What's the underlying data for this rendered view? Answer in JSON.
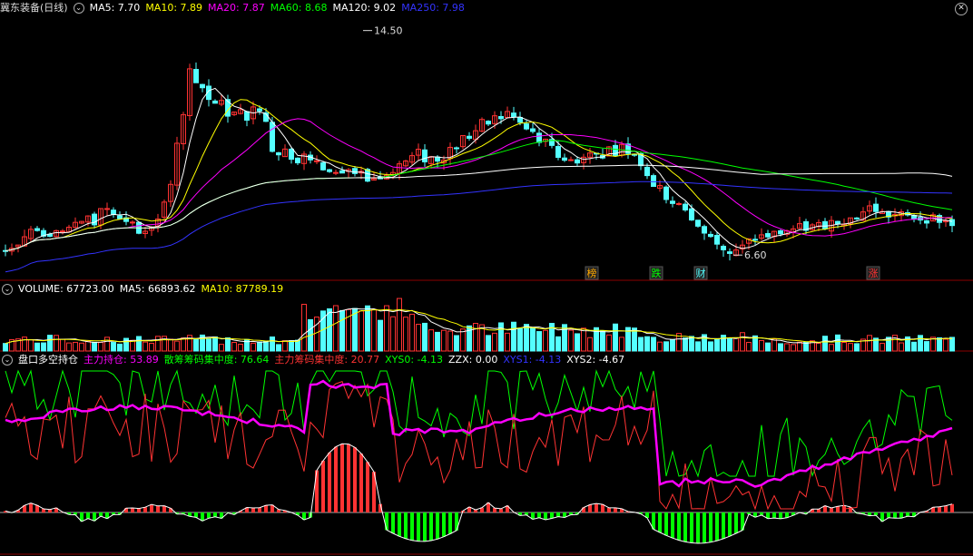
{
  "header": {
    "stock_name": "冀东装备(日线)",
    "ma_labels": [
      {
        "text": "MA5: 7.70",
        "color": "#ffffff"
      },
      {
        "text": "MA10: 7.89",
        "color": "#ffff00"
      },
      {
        "text": "MA20: 7.87",
        "color": "#ff00ff"
      },
      {
        "text": "MA60: 8.68",
        "color": "#00ff00"
      },
      {
        "text": "MA120: 9.02",
        "color": "#ffffff"
      },
      {
        "text": "MA250: 7.98",
        "color": "#3333ff"
      }
    ]
  },
  "volume_header": {
    "labels": [
      {
        "text": "VOLUME: 67723.00",
        "color": "#ffffff"
      },
      {
        "text": "MA5: 66893.62",
        "color": "#ffffff"
      },
      {
        "text": "MA10: 87789.19",
        "color": "#ffff00"
      }
    ]
  },
  "indicator_header": {
    "labels": [
      {
        "text": "盘口多空持仓",
        "color": "#ffffff"
      },
      {
        "text": "主力持仓: 53.89",
        "color": "#ff00ff"
      },
      {
        "text": "散筹筹码集中度: 76.64",
        "color": "#00ff00"
      },
      {
        "text": "主力筹码集中度: 20.77",
        "color": "#ff3333"
      },
      {
        "text": "XYS0: -4.13",
        "color": "#00ff00"
      },
      {
        "text": "ZZX: 0.00",
        "color": "#ffffff"
      },
      {
        "text": "XYS1: -4.13",
        "color": "#3333ff"
      },
      {
        "text": "XYS2: -4.67",
        "color": "#ffffff"
      }
    ]
  },
  "colors": {
    "up": "#ff3333",
    "down": "#54ffff",
    "ma5": "#ffffff",
    "ma10": "#ffff00",
    "ma20": "#ff00ff",
    "ma60": "#00ff00",
    "ma120": "#ffffff",
    "ma250": "#3333ff",
    "grid": "#8b0000"
  },
  "chart_data": [
    {
      "type": "candlestick",
      "title": "冀东装备(日线)",
      "ylim": [
        6.0,
        15.0
      ],
      "annotations": [
        {
          "text": "14.50",
          "value": 14.5
        },
        {
          "text": "6.60",
          "value": 6.6
        }
      ],
      "markers": [
        {
          "text": "榜",
          "color": "#ffaa00"
        },
        {
          "text": "跌",
          "color": "#00ff00"
        },
        {
          "text": "财",
          "color": "#54ffff"
        },
        {
          "text": "涨",
          "color": "#ff3333"
        }
      ]
    },
    {
      "type": "bar",
      "title": "VOLUME"
    },
    {
      "type": "line",
      "title": "盘口多空持仓",
      "ylim": [
        -20,
        80
      ]
    }
  ]
}
